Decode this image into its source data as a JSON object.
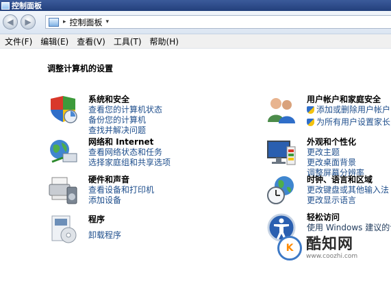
{
  "window": {
    "title": "控制面板"
  },
  "address": {
    "path": "控制面板"
  },
  "menu": [
    "文件(F)",
    "编辑(E)",
    "查看(V)",
    "工具(T)",
    "帮助(H)"
  ],
  "main": {
    "heading": "调整计算机的设置",
    "categories": [
      {
        "title": "系统和安全",
        "icon": "system-security-icon",
        "links": [
          "查看您的计算机状态",
          "备份您的计算机",
          "查找并解决问题"
        ]
      },
      {
        "title": "网络和 Internet",
        "icon": "network-icon",
        "links": [
          "查看网络状态和任务",
          "选择家庭组和共享选项"
        ]
      },
      {
        "title": "硬件和声音",
        "icon": "hardware-sound-icon",
        "links": [
          "查看设备和打印机",
          "添加设备"
        ]
      },
      {
        "title": "程序",
        "icon": "programs-icon",
        "links": [
          "卸载程序"
        ]
      },
      {
        "title": "用户帐户和家庭安全",
        "icon": "user-accounts-icon",
        "links": [
          "添加或删除用户帐户",
          "为所有用户设置家长"
        ]
      },
      {
        "title": "外观和个性化",
        "icon": "appearance-icon",
        "links": [
          "更改主题",
          "更改桌面背景",
          "调整屏幕分辨率"
        ]
      },
      {
        "title": "时钟、语言和区域",
        "icon": "clock-region-icon",
        "links": [
          "更改键盘或其他输入法",
          "更改显示语言"
        ]
      },
      {
        "title": "轻松访问",
        "icon": "ease-of-access-icon",
        "links": [
          "使用 Windows 建议的设"
        ]
      }
    ]
  },
  "watermark": {
    "name": "酷知网",
    "url": "www.coozhi.com"
  },
  "colors": {
    "link": "#1e4e8c",
    "titlebar": "#23407c"
  }
}
